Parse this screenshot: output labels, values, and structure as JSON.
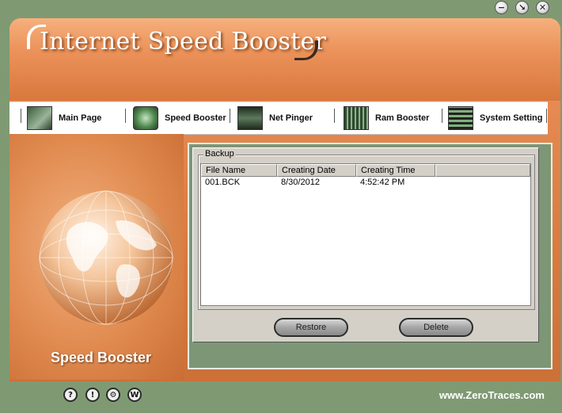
{
  "window_controls": {
    "minimize": "−",
    "help": "↘",
    "close": "✕"
  },
  "app": {
    "title": "Internet Speed Booster"
  },
  "nav": {
    "items": [
      {
        "label": "Main Page",
        "icon": "main-page-icon"
      },
      {
        "label": "Speed Booster",
        "icon": "speed-booster-icon"
      },
      {
        "label": "Net Pinger",
        "icon": "net-pinger-icon"
      },
      {
        "label": "Ram Booster",
        "icon": "ram-booster-icon"
      },
      {
        "label": "System Setting",
        "icon": "system-setting-icon"
      }
    ]
  },
  "left_panel": {
    "label": "Speed Booster"
  },
  "backup": {
    "group_title": "Backup",
    "columns": [
      "File Name",
      "Creating Date",
      "Creating Time"
    ],
    "rows": [
      {
        "file_name": "001.BCK",
        "date": "8/30/2012",
        "time": "4:52:42 PM"
      }
    ],
    "restore_label": "Restore",
    "delete_label": "Delete"
  },
  "footer": {
    "icons": [
      "?",
      "!",
      "⚙",
      "W"
    ],
    "website": "www.ZeroTraces.com"
  },
  "colors": {
    "accent": "#e68a52",
    "frame_green": "#7f9a73"
  }
}
